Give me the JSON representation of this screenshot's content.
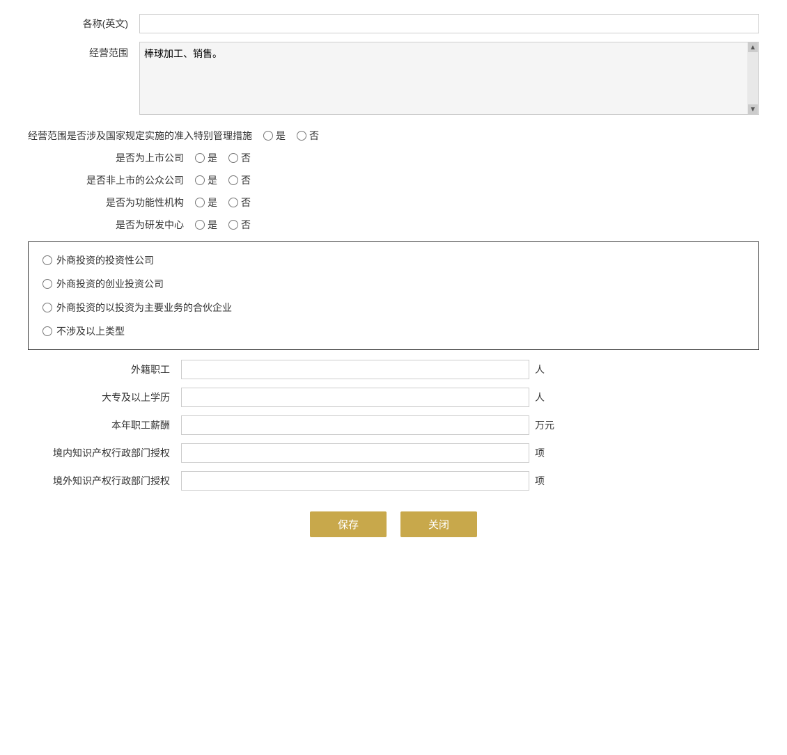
{
  "form": {
    "labels": {
      "name_en": "各称(英文)",
      "business_scope": "经营范围",
      "business_scope_special": "经营范围是否涉及国家规定实施的准入特别管理措施",
      "is_listed": "是否为上市公司",
      "is_public_unlisted": "是否非上市的公众公司",
      "is_functional": "是否为功能性机构",
      "is_rnd": "是否为研发中心",
      "foreign_workers": "外籍职工",
      "college_above": "大专及以上学历",
      "annual_salary": "本年职工薪酬",
      "domestic_ip": "境内知识产权行政部门授权",
      "foreign_ip": "境外知识产权行政部门授权"
    },
    "units": {
      "person": "人",
      "wan_yuan": "万元",
      "xiang": "项"
    },
    "options": {
      "yes": "是",
      "no": "否"
    },
    "textarea_content": "棒球加工、销售。",
    "bordered_options": [
      "外商投资的投资性公司",
      "外商投资的创业投资公司",
      "外商投资的以投资为主要业务的合伙企业",
      "不涉及以上类型"
    ],
    "buttons": {
      "save": "保存",
      "close": "关闭"
    }
  }
}
